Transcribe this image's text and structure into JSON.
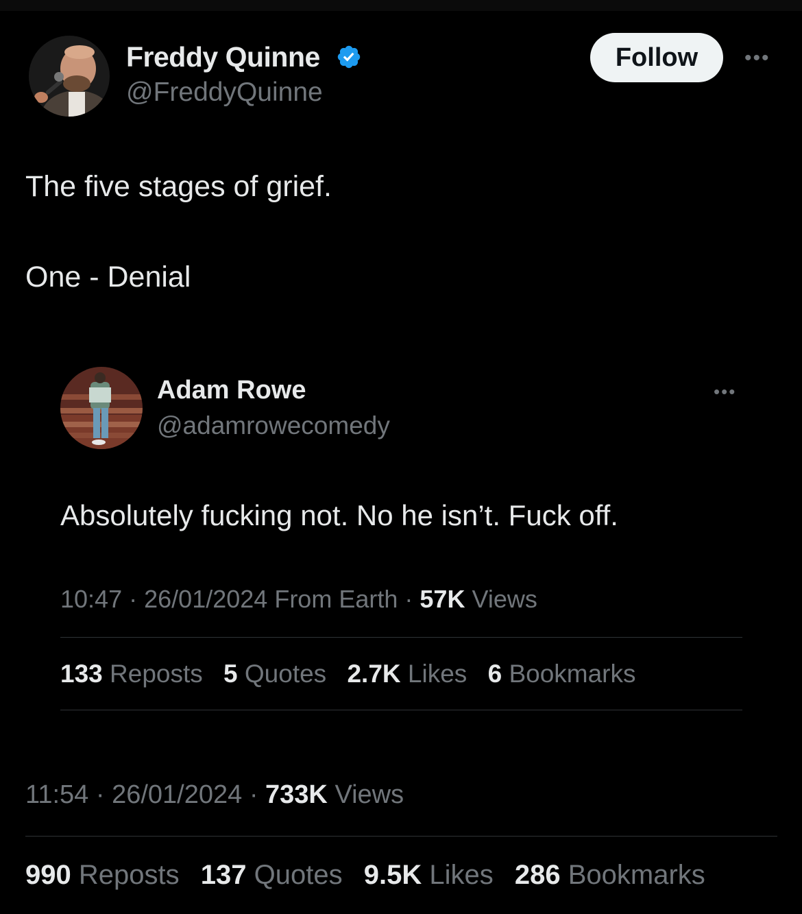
{
  "main_tweet": {
    "author": {
      "display_name": "Freddy Quinne",
      "handle": "@FreddyQuinne",
      "verified": true,
      "verified_icon": "verified-badge-icon"
    },
    "follow_label": "Follow",
    "more_icon": "more-options-icon",
    "text_lines": [
      "The five stages of grief.",
      "One - Denial"
    ],
    "time": "11:54",
    "date": "26/01/2024",
    "views_count": "733K",
    "views_label": "Views",
    "stats": [
      {
        "count": "990",
        "label": "Reposts"
      },
      {
        "count": "137",
        "label": "Quotes"
      },
      {
        "count": "9.5K",
        "label": "Likes"
      },
      {
        "count": "286",
        "label": "Bookmarks"
      }
    ]
  },
  "quoted_tweet": {
    "author": {
      "display_name": "Adam Rowe",
      "handle": "@adamrowecomedy"
    },
    "more_icon": "more-options-icon",
    "text": "Absolutely fucking not. No he isn’t. Fuck off.",
    "time": "10:47",
    "date": "26/01/2024",
    "source": "From Earth",
    "views_count": "57K",
    "views_label": "Views",
    "stats": [
      {
        "count": "133",
        "label": "Reposts"
      },
      {
        "count": "5",
        "label": "Quotes"
      },
      {
        "count": "2.7K",
        "label": "Likes"
      },
      {
        "count": "6",
        "label": "Bookmarks"
      }
    ]
  },
  "separator": "·",
  "colors": {
    "background": "#000000",
    "text_primary": "#e7e9ea",
    "text_secondary": "#71767b",
    "verified_blue": "#1d9bf0",
    "follow_bg": "#eff3f4",
    "divider": "#2f3336"
  }
}
